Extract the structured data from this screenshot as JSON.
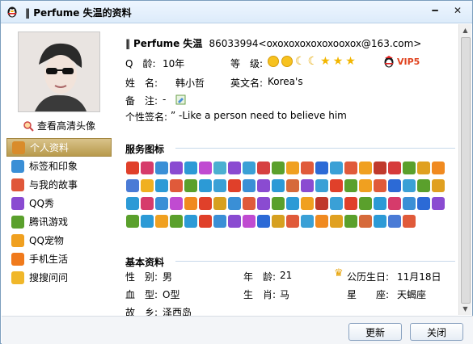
{
  "window": {
    "title": "Perfume 失温的资料",
    "title_bars": "‖"
  },
  "left": {
    "hd_link": "查看高清头像",
    "nav": [
      {
        "label": "个人资料",
        "color": "#d98c2b"
      },
      {
        "label": "标签和印象",
        "color": "#3a8fd6"
      },
      {
        "label": "与我的故事",
        "color": "#e0573a"
      },
      {
        "label": "QQ秀",
        "color": "#8a4bd1"
      },
      {
        "label": "腾讯游戏",
        "color": "#5aa02c"
      },
      {
        "label": "QQ宠物",
        "color": "#f0a020"
      },
      {
        "label": "手机生活",
        "color": "#f07a1c"
      },
      {
        "label": "搜搜问问",
        "color": "#f0b72a"
      }
    ]
  },
  "profile": {
    "bars": "‖",
    "nickname": "Perfume 失温",
    "qq_email": "86033994<oxoxoxoxoxoxooxox@163.com>",
    "age_label": "Q　龄:",
    "age_value": "10年",
    "level_label": "等　级:",
    "vip_text": "VIP5",
    "name_label": "姓　名:",
    "name_value": "韩小哲",
    "english_label": "英文名:",
    "english_value": "Korea's",
    "note_label": "备　注:",
    "note_value": "-",
    "signature_label": "个性签名:",
    "signature_value": "” -Like a person need to believe him"
  },
  "services": {
    "heading": "服务图标",
    "icons": [
      "#e0402a",
      "#d63b6b",
      "#3a8fd6",
      "#8a4bd1",
      "#2c9ad6",
      "#c04bd1",
      "#4bb0d1",
      "#8a4bd1",
      "#3aa0d6",
      "#d64040",
      "#5aa02c",
      "#f0a020",
      "#e05a3a",
      "#2c6ad6",
      "#3aa0d6",
      "#e05a3a",
      "#f0a020",
      "#c0392b",
      "#d63b3b",
      "#5aa02c",
      "#e0a020",
      "#f08a20",
      "#4a7bd6",
      "#f0b020",
      "#2c9ad6",
      "#e05a3a",
      "#5aa02c",
      "#2c9ad6",
      "#3aa0d6",
      "#e0402a",
      "#3a8fd6",
      "#8a4bd1",
      "#2c9ad6",
      "#d66a3b",
      "#8a4bd1",
      "#3aa0d6",
      "#e0402a",
      "#5aa02c",
      "#f0a020",
      "#e05a3a",
      "#2c6ad6",
      "#3aa0d6",
      "#5aa02c",
      "#e0a020",
      "#2c9ad6",
      "#d63b6b",
      "#3a8fd6",
      "#c04bd1",
      "#f08a20",
      "#e0402a",
      "#d6a020",
      "#3a8fd6",
      "#e05a3a",
      "#8a4bd1",
      "#5aa02c",
      "#2c9ad6",
      "#f0a020",
      "#c0392b",
      "#3aa0d6",
      "#e0402a",
      "#5aa02c",
      "#2c9ad6",
      "#d63b6b",
      "#3a8fd6",
      "#2c6ad6",
      "#8a4bd1",
      "#5aa02c",
      "#2c9ad6",
      "#f0a020",
      "#5aa02c",
      "#2c9ad6",
      "#e0402a",
      "#3a8fd6",
      "#8a4bd1",
      "#c04bd1",
      "#2c6ad6",
      "#d6a020",
      "#e05a3a",
      "#3aa0d6",
      "#f08a20",
      "#e0a020",
      "#5aa02c",
      "#d66a3b",
      "#2c9ad6",
      "#4a7bd6",
      "#e05a3a"
    ]
  },
  "basic": {
    "heading": "基本资料",
    "gender_label": "性　别:",
    "gender_value": "男",
    "age_label": "年　龄:",
    "age_value": "21",
    "birthday_label": "公历生日:",
    "birthday_value": "11月18日",
    "blood_label": "血　型:",
    "blood_value": "O型",
    "zodiac_label": "生　肖:",
    "zodiac_value": "马",
    "star_label": "星　　座:",
    "star_value": "天蝎座",
    "hometown_label": "故　乡:",
    "hometown_value": "泽西岛"
  },
  "buttons": {
    "refresh": "更新",
    "close": "关闭"
  }
}
